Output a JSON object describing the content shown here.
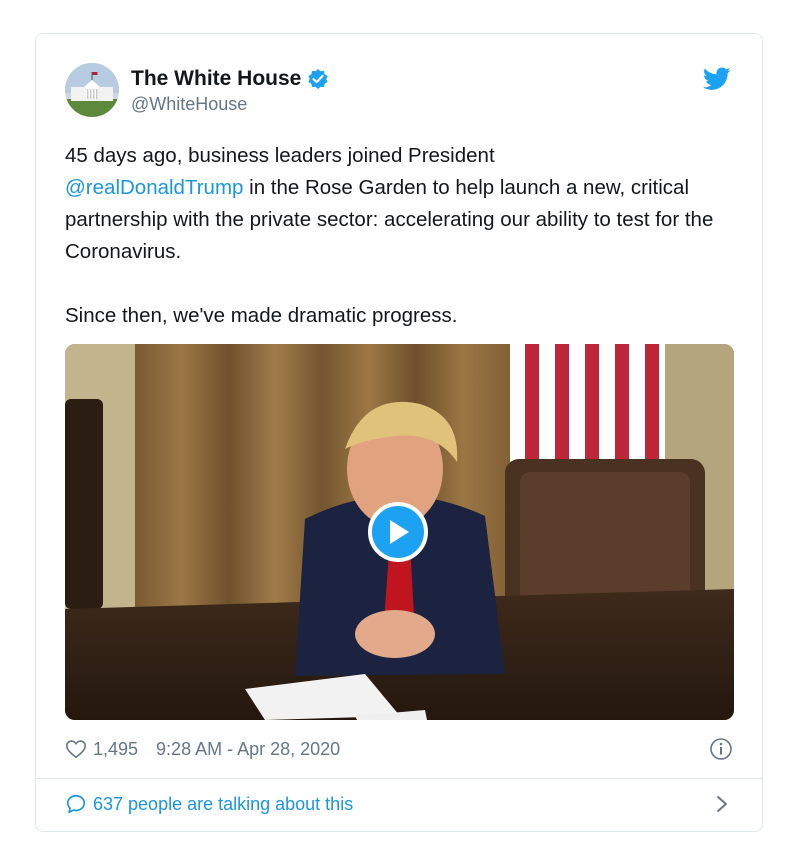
{
  "tweet": {
    "author": {
      "name": "The White House",
      "handle": "@WhiteHouse",
      "verified": true
    },
    "text": {
      "line1_before": "45 days ago, business leaders joined President",
      "mention": "@realDonaldTrump",
      "line1_after": " in the Rose Garden to help launch a new, critical partnership with the private sector: accelerating our ability to test for the Coronavirus.",
      "paragraph2": "Since then, we've made dramatic progress."
    },
    "media": {
      "type": "video",
      "icon": "play-icon"
    },
    "likes": "1,495",
    "timestamp": "9:28 AM - Apr 28, 2020",
    "conversation": "637 people are talking about this"
  },
  "colors": {
    "accent": "#1da1f2",
    "link": "#1b95e0",
    "muted": "#657786",
    "border": "#e1e8ed"
  },
  "icons": [
    "verified-badge-icon",
    "twitter-bird-icon",
    "heart-icon",
    "info-icon",
    "speech-bubble-icon",
    "chevron-right-icon",
    "play-icon"
  ]
}
